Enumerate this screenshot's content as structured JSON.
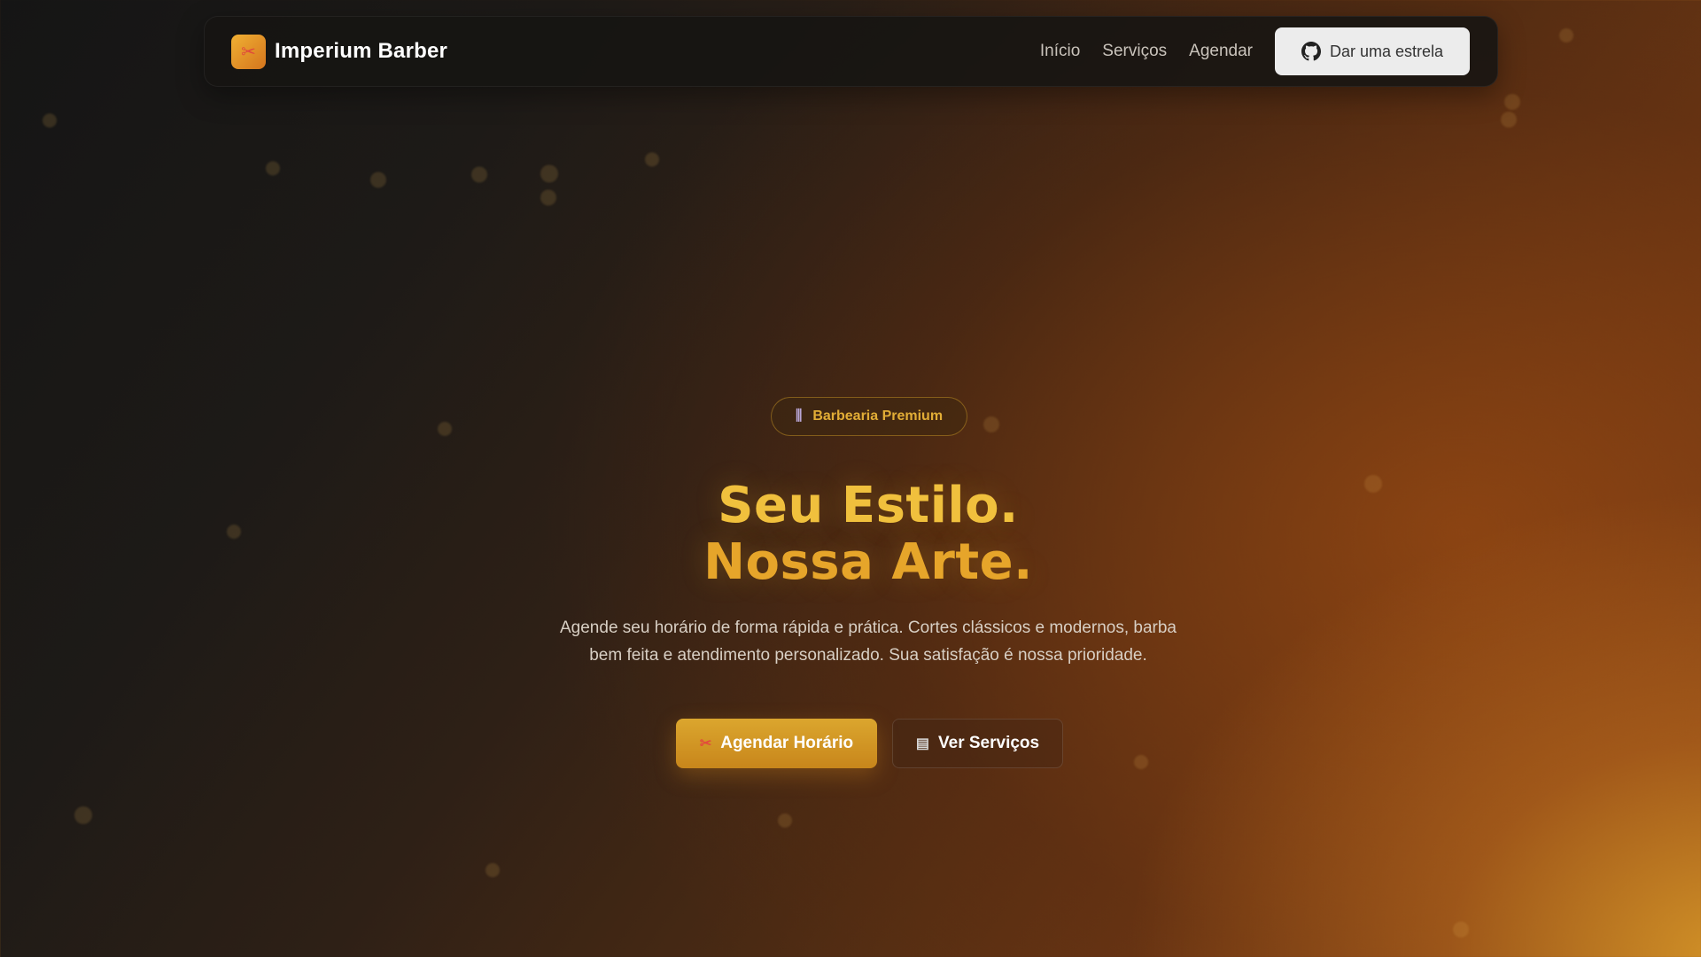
{
  "brand": {
    "name": "Imperium Barber",
    "logo_icon": "scissors-icon"
  },
  "nav": {
    "links": [
      "Início",
      "Serviços",
      "Agendar"
    ],
    "star_button": {
      "label": "Dar uma estrela",
      "icon": "github-icon"
    }
  },
  "hero": {
    "badge": {
      "label": "Barbearia Premium",
      "icon": "barber-pole-icon"
    },
    "title_line1": "Seu Estilo.",
    "title_line2": "Nossa Arte.",
    "subtitle_line1": "Agende seu horário de forma rápida e prática. Cortes clássicos e modernos, barba",
    "subtitle_line2": "bem feita e atendimento personalizado. Sua satisfação é nossa prioridade.",
    "primary_button": {
      "label": "Agendar Horário",
      "icon": "scissors-icon"
    },
    "secondary_button": {
      "label": "Ver Serviços",
      "icon": "clipboard-icon"
    }
  },
  "colors": {
    "accent": "#e2ad36",
    "accent_dark": "#c8861b",
    "title_gold": "#f0c03d",
    "navbar_bg": "#161412"
  }
}
